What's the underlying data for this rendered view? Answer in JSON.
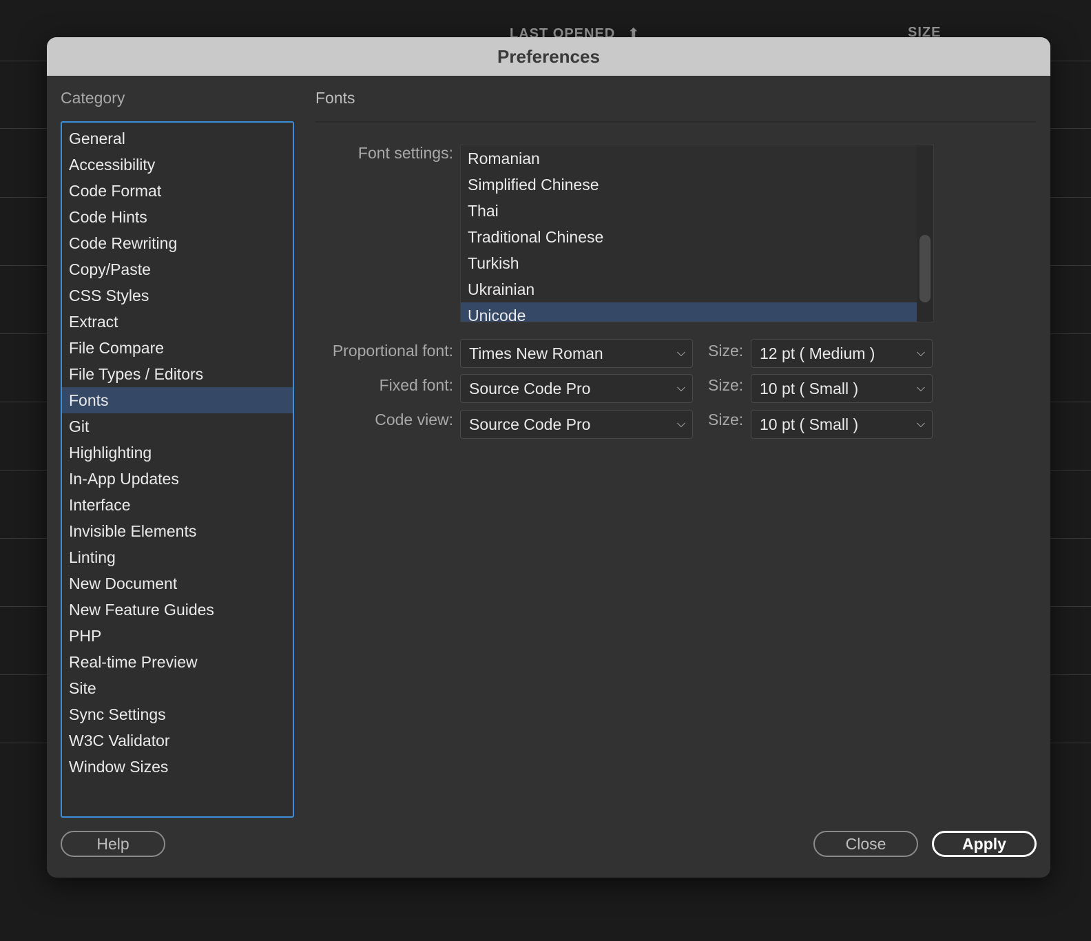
{
  "background": {
    "column_headers": [
      "LAST OPENED",
      "SIZE"
    ],
    "sort_icon": "arrow-up-icon"
  },
  "dialog": {
    "title": "Preferences",
    "category_label": "Category",
    "categories": [
      "General",
      "Accessibility",
      "Code Format",
      "Code Hints",
      "Code Rewriting",
      "Copy/Paste",
      "CSS Styles",
      "Extract",
      "File Compare",
      "File Types / Editors",
      "Fonts",
      "Git",
      "Highlighting",
      "In-App Updates",
      "Interface",
      "Invisible Elements",
      "Linting",
      "New Document",
      "New Feature Guides",
      "PHP",
      "Real-time Preview",
      "Site",
      "Sync Settings",
      "W3C Validator",
      "Window Sizes"
    ],
    "selected_category": "Fonts"
  },
  "fonts": {
    "section_title": "Fonts",
    "font_settings_label": "Font settings:",
    "encodings": [
      "Romanian",
      "Simplified Chinese",
      "Thai",
      "Traditional Chinese",
      "Turkish",
      "Ukrainian",
      "Unicode"
    ],
    "selected_encoding": "Unicode",
    "proportional": {
      "label": "Proportional font:",
      "value": "Times New Roman",
      "size_label": "Size:",
      "size_value": "12 pt  ( Medium )"
    },
    "fixed": {
      "label": "Fixed font:",
      "value": "Source Code Pro",
      "size_label": "Size:",
      "size_value": "10 pt  ( Small )"
    },
    "code_view": {
      "label": "Code view:",
      "value": "Source Code Pro",
      "size_label": "Size:",
      "size_value": "10 pt  ( Small )"
    }
  },
  "buttons": {
    "help": "Help",
    "close": "Close",
    "apply": "Apply"
  },
  "colors": {
    "accent_border": "#3b8fd9",
    "selection": "#354866",
    "dialog_bg": "#323232",
    "titlebar_bg": "#c9c9c9"
  }
}
